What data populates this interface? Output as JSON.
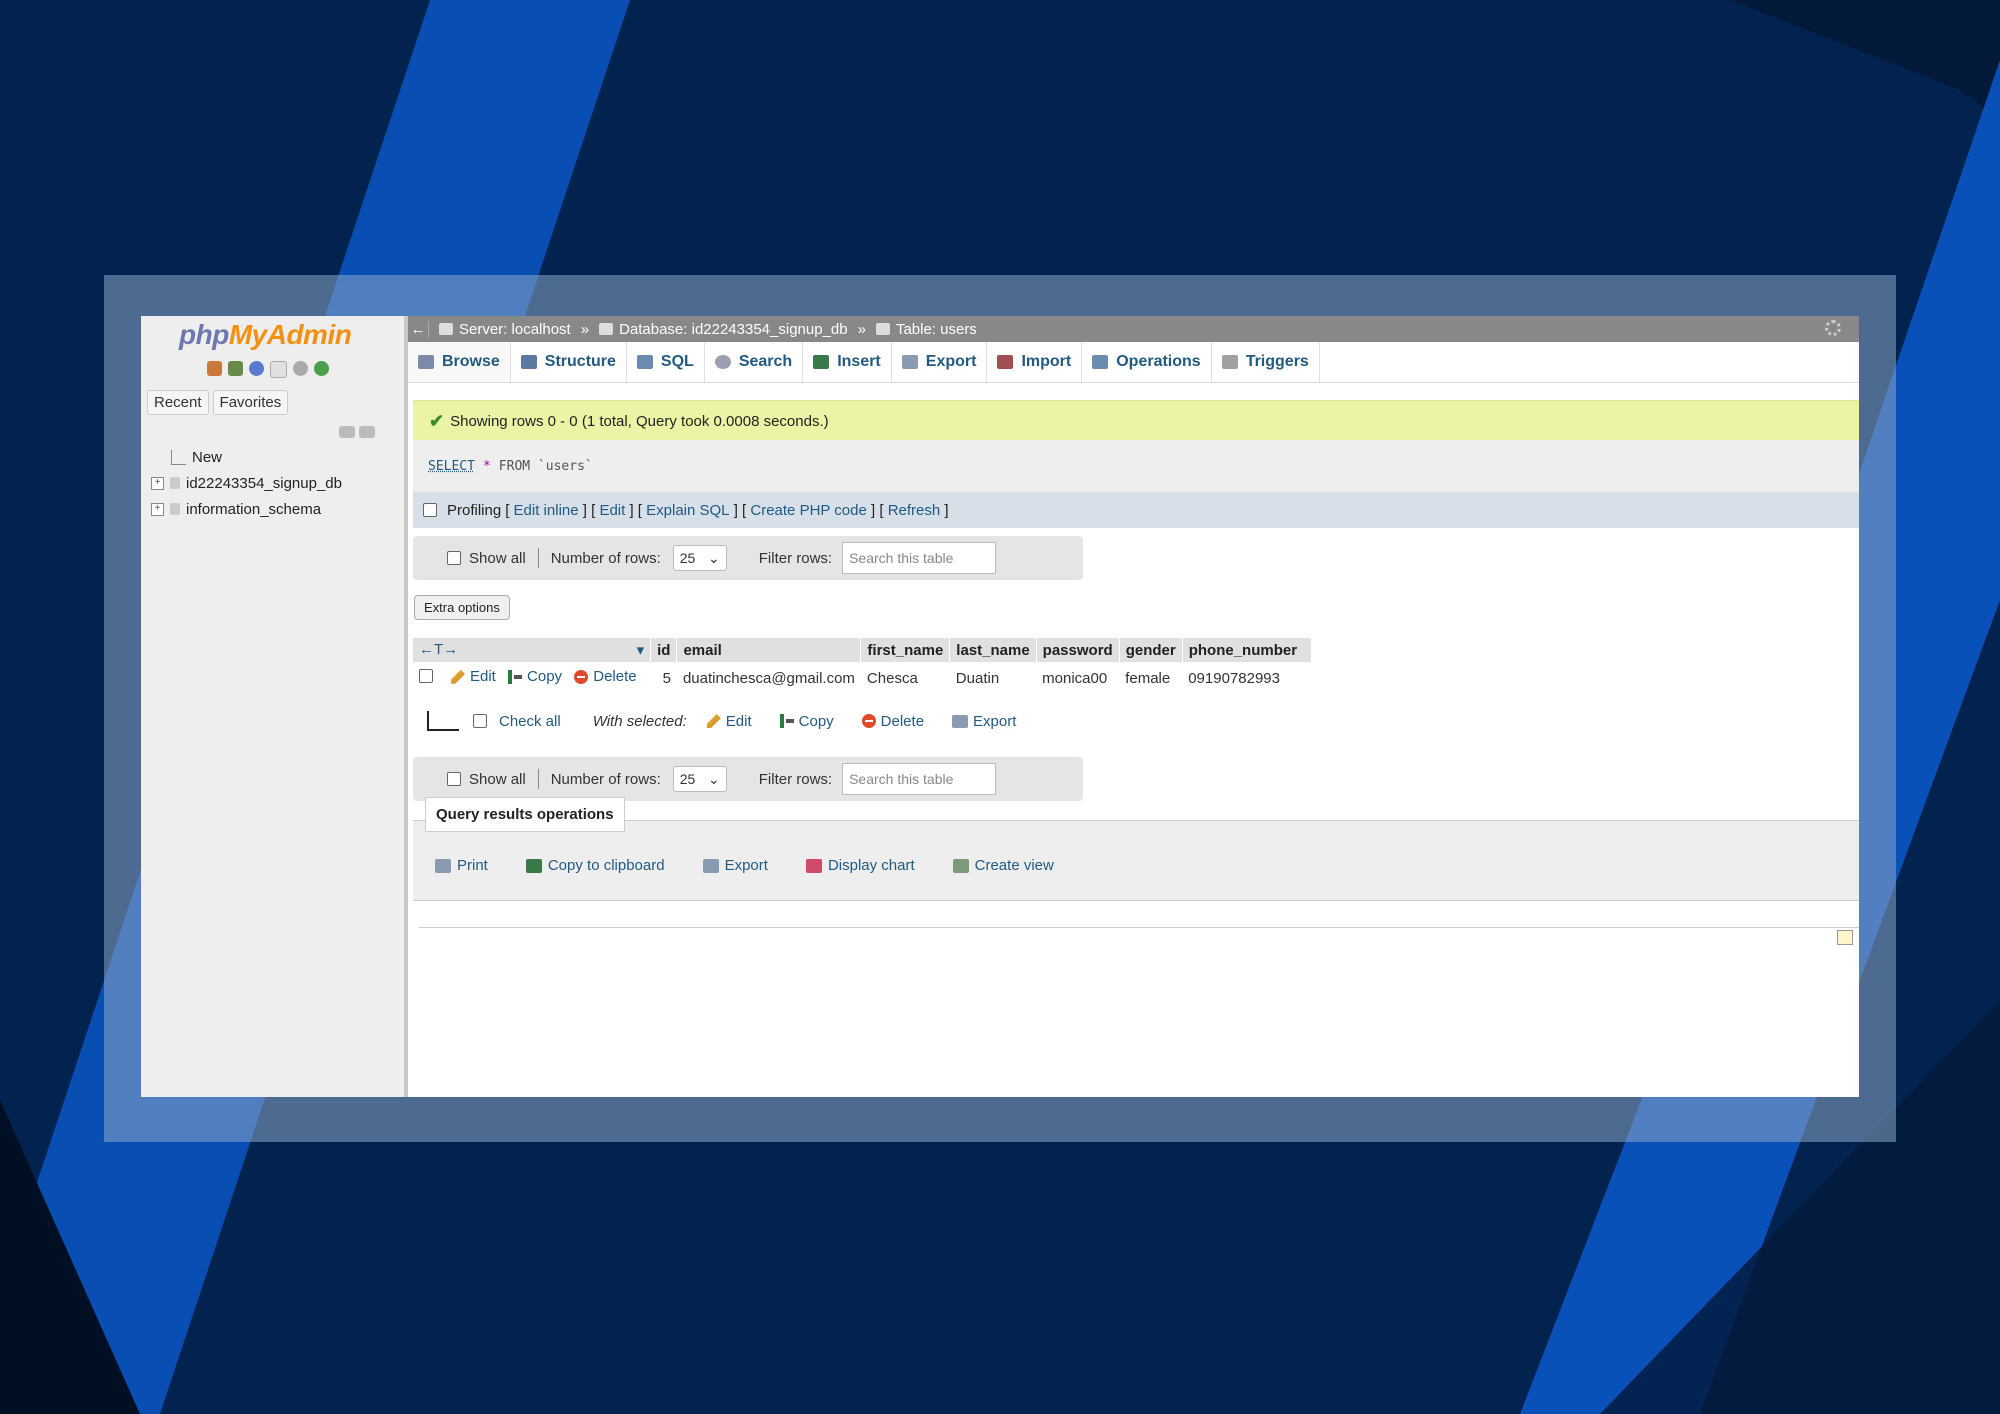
{
  "sidebar": {
    "logo": {
      "php": "php",
      "my": "My",
      "admin": "Admin"
    },
    "tabs": [
      "Recent",
      "Favorites"
    ],
    "tree": [
      {
        "label": "New"
      },
      {
        "label": "id22243354_signup_db"
      },
      {
        "label": "information_schema"
      }
    ]
  },
  "breadcrumb": {
    "back": "←",
    "server": "Server: localhost",
    "database": "Database: id22243354_signup_db",
    "table": "Table: users",
    "separator": "»"
  },
  "tabs": [
    {
      "label": "Browse",
      "icon": "browse-icon",
      "color": "#7a8aa8"
    },
    {
      "label": "Structure",
      "icon": "structure-icon",
      "color": "#5a7aa0"
    },
    {
      "label": "SQL",
      "icon": "sql-icon",
      "color": "#6a8ab0"
    },
    {
      "label": "Search",
      "icon": "search-icon",
      "color": "#9aa0b0"
    },
    {
      "label": "Insert",
      "icon": "insert-icon",
      "color": "#3a7a4a"
    },
    {
      "label": "Export",
      "icon": "export-icon",
      "color": "#8a9ab0"
    },
    {
      "label": "Import",
      "icon": "import-icon",
      "color": "#a05050"
    },
    {
      "label": "Operations",
      "icon": "wrench-icon",
      "color": "#6a8ab0"
    },
    {
      "label": "Triggers",
      "icon": "triggers-icon",
      "color": "#a0a0a0"
    }
  ],
  "message": "Showing rows 0 - 0 (1 total, Query took 0.0008 seconds.)",
  "sql": {
    "keyword": "SELECT",
    "star": "*",
    "rest": "FROM `users`"
  },
  "sql_options": {
    "profiling": "Profiling",
    "links": [
      "Edit inline",
      "Edit",
      "Explain SQL",
      "Create PHP code",
      "Refresh"
    ]
  },
  "nav": {
    "show_all": "Show all",
    "number_of_rows": "Number of rows:",
    "rows_value": "25",
    "filter_rows": "Filter rows:",
    "filter_placeholder": "Search this table"
  },
  "extra_options": "Extra options",
  "table": {
    "sort_arrows": "←T→",
    "columns": [
      "id",
      "email",
      "first_name",
      "last_name",
      "password",
      "gender",
      "phone_number"
    ],
    "rows": [
      {
        "actions": [
          "Edit",
          "Copy",
          "Delete"
        ],
        "cells": [
          "5",
          "duatinchesca@gmail.com",
          "Chesca",
          "Duatin",
          "monica00",
          "female",
          "09190782993"
        ]
      }
    ]
  },
  "bulk": {
    "check_all": "Check all",
    "with_selected": "With selected:",
    "actions": [
      "Edit",
      "Copy",
      "Delete",
      "Export"
    ]
  },
  "query_results": {
    "title": "Query results operations",
    "items": [
      {
        "label": "Print",
        "icon": "print-icon",
        "color": "#8a9ab0"
      },
      {
        "label": "Copy to clipboard",
        "icon": "copy-icon",
        "color": "#3a7a4a"
      },
      {
        "label": "Export",
        "icon": "export-icon",
        "color": "#8a9ab0"
      },
      {
        "label": "Display chart",
        "icon": "chart-icon",
        "color": "#d04a6a"
      },
      {
        "label": "Create view",
        "icon": "create-view-icon",
        "color": "#7a9a7a"
      }
    ]
  }
}
